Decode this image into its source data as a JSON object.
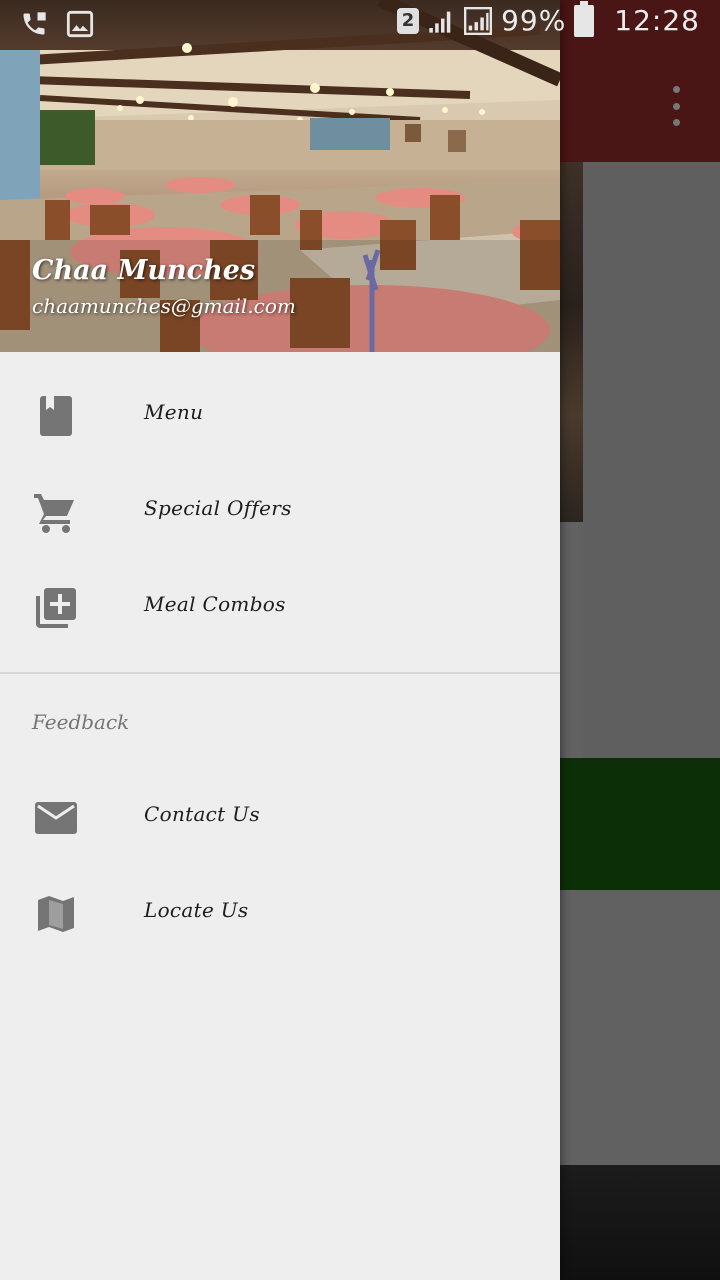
{
  "status_bar": {
    "sim_slot": "2",
    "battery": "99%",
    "time": "12:28",
    "icons": [
      "call-forwarding-icon",
      "image-notification-icon",
      "signal-icon",
      "signal-icon",
      "battery-icon"
    ]
  },
  "drawer": {
    "header": {
      "name": "Chaa Munches",
      "email": "chaamunches@gmail.com"
    },
    "items": [
      {
        "label": "Menu",
        "icon": "book-icon"
      },
      {
        "label": "Special Offers",
        "icon": "cart-icon"
      },
      {
        "label": "Meal Combos",
        "icon": "library-add-icon"
      }
    ],
    "feedback_section": {
      "title": "Feedback",
      "items": [
        {
          "label": "Contact Us",
          "icon": "mail-icon"
        },
        {
          "label": "Locate Us",
          "icon": "map-icon"
        }
      ]
    }
  },
  "colors": {
    "toolbar": "#4a1515",
    "drawer_bg": "#eeeeee",
    "icon_gray": "#757575",
    "green_block": "#0d2f07",
    "scrim": "#616161"
  }
}
